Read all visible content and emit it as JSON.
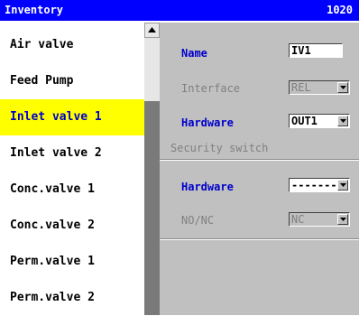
{
  "title": {
    "left": "Inventory",
    "right": "1020"
  },
  "list": {
    "items": [
      {
        "label": "Air valve"
      },
      {
        "label": "Feed Pump"
      },
      {
        "label": "Inlet valve 1"
      },
      {
        "label": "Inlet valve 2"
      },
      {
        "label": "Conc.valve 1"
      },
      {
        "label": "Conc.valve 2"
      },
      {
        "label": "Perm.valve 1"
      },
      {
        "label": "Perm.valve 2"
      }
    ],
    "selected_index": 2
  },
  "details": {
    "name_label": "Name",
    "name_value": "IV1",
    "interface_label": "Interface",
    "interface_value": "REL",
    "hardware_label": "Hardware",
    "hardware_value": "OUT1",
    "security_section": "Security switch",
    "sec_hardware_label": "Hardware",
    "sec_hardware_value": "-------",
    "nonc_label": "NO/NC",
    "nonc_value": "NC"
  },
  "colors": {
    "titlebar": "#0000ff",
    "selected": "#ffff00",
    "accent_text": "#0000cc",
    "panel": "#c0c0c0"
  }
}
